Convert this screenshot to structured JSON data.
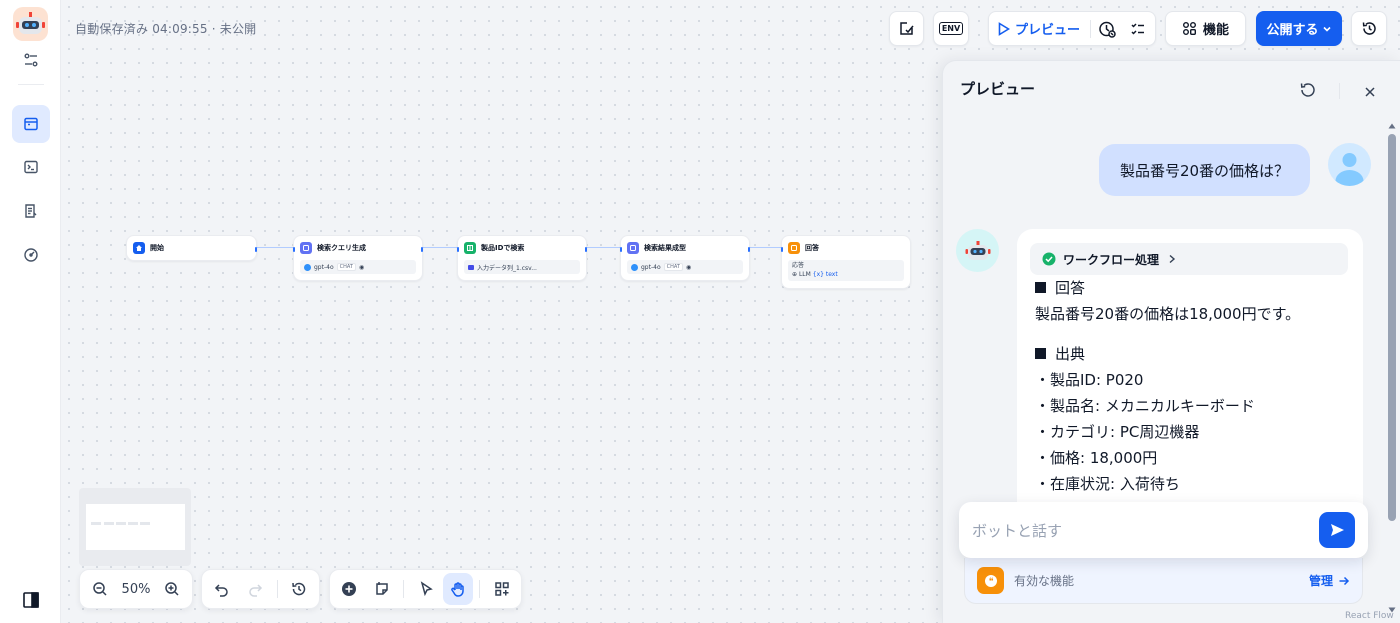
{
  "header": {
    "autosave": "自動保存済み 04:09:55 · 未公開"
  },
  "toolbar": {
    "preview_label": "プレビュー",
    "features_label": "機能",
    "publish_label": "公開する",
    "env_label": "ENV"
  },
  "workflow": {
    "nodes": [
      {
        "title": "開始",
        "color": "#155eef"
      },
      {
        "title": "検索クエリ生成",
        "color": "#6172f3",
        "body": "gpt-4o",
        "tag": "CHAT"
      },
      {
        "title": "製品IDで検索",
        "color": "#17b26a",
        "body": "入力データ列_1.csv..."
      },
      {
        "title": "検索結果成型",
        "color": "#6172f3",
        "body": "gpt-4o",
        "tag": "CHAT"
      },
      {
        "title": "回答",
        "color": "#f79009",
        "body_label": "応答",
        "body_a": "LLM",
        "body_b": "text"
      }
    ]
  },
  "zoom": {
    "value": "50%"
  },
  "preview": {
    "title": "プレビュー",
    "user_message": "製品番号20番の価格は？",
    "workflow_label": "ワークフロー処理",
    "answer": {
      "h1": "回答",
      "text": "製品番号20番の価格は18,000円です。",
      "h2": "出典",
      "items": [
        "・製品ID: P020",
        "・製品名: メカニカルキーボード",
        "・カテゴリ: PC周辺機器",
        "・価格: 18,000円",
        "・在庫状況: 入荷待ち"
      ]
    },
    "input_placeholder": "ボットと話す",
    "features_label": "有効な機能",
    "manage_label": "管理"
  },
  "footer": {
    "react_flow": "React Flow"
  },
  "colors": {
    "accent": "#155eef",
    "user_bubble": "#d1e0ff",
    "panel_bg": "#f2f4f7"
  }
}
